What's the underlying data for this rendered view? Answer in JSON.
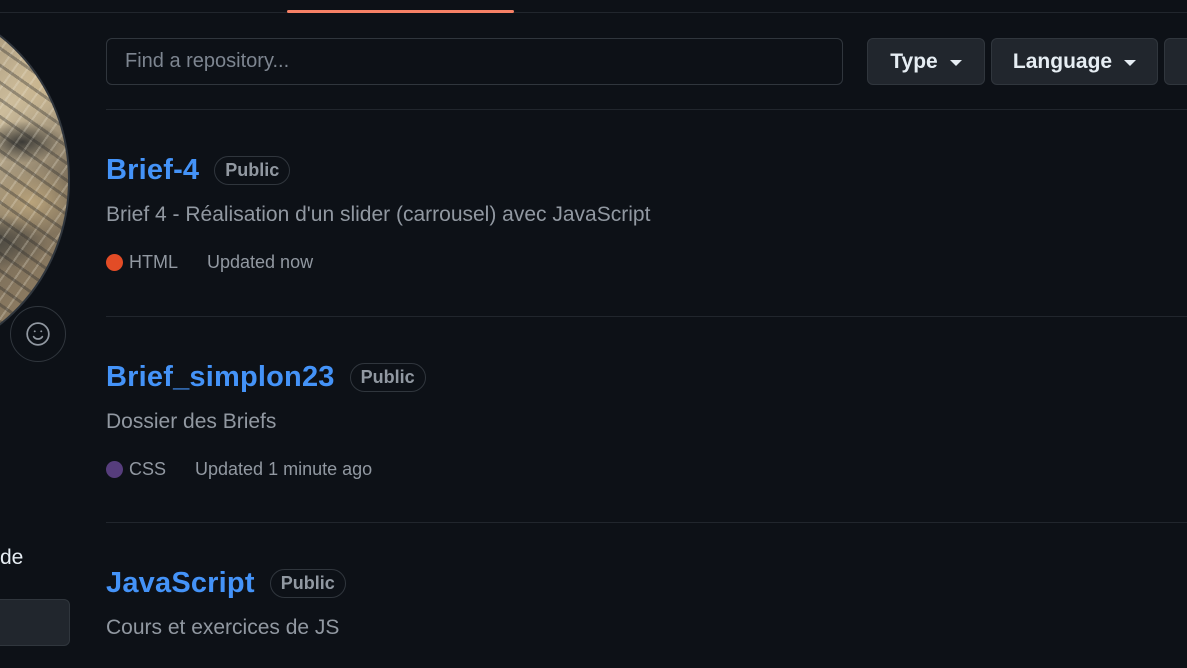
{
  "search": {
    "placeholder": "Find a repository..."
  },
  "filters": {
    "type_label": "Type",
    "language_label": "Language"
  },
  "sidebar": {
    "text_fragment": "de"
  },
  "colors": {
    "link": "#4493f8",
    "active_tab_underline": "#f78166"
  },
  "repositories": [
    {
      "name": "Brief-4",
      "visibility": "Public",
      "description": "Brief 4 - Réalisation d'un slider (carrousel) avec JavaScript",
      "language": "HTML",
      "language_color": "#e34c26",
      "updated": "Updated now"
    },
    {
      "name": "Brief_simplon23",
      "visibility": "Public",
      "description": "Dossier des Briefs",
      "language": "CSS",
      "language_color": "#563d7c",
      "updated": "Updated 1 minute ago"
    },
    {
      "name": "JavaScript",
      "visibility": "Public",
      "description": "Cours et exercices de JS"
    }
  ]
}
